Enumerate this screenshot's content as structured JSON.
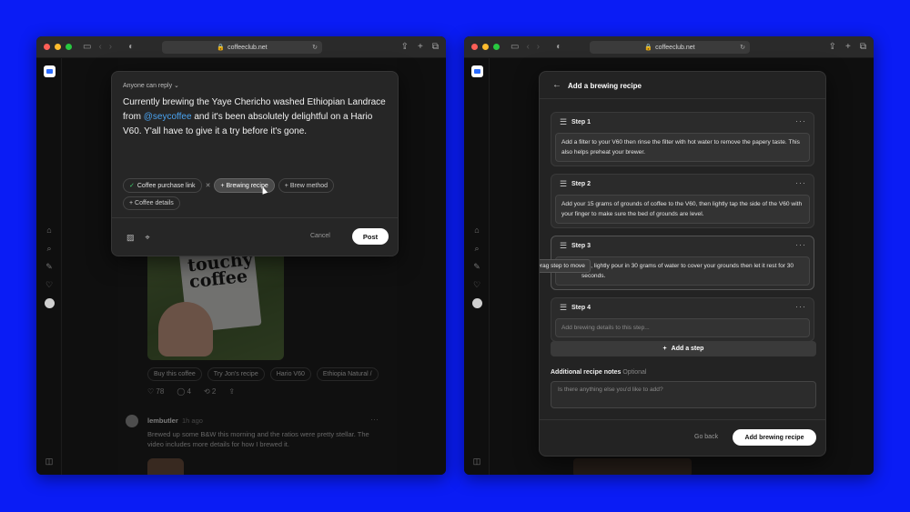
{
  "browser": {
    "url": "coffeeclub.net"
  },
  "composer": {
    "reply_setting": "Anyone can reply",
    "text_before": "Currently brewing the Yaye Chericho washed Ethiopian Landrace from ",
    "mention": "@seycoffee",
    "text_after": " and it's been absolutely delightful on a Hario V60. Y'all have to give it a try before it's gone.",
    "chips": {
      "purchase_link": "Coffee purchase link",
      "brewing_recipe": "+ Brewing recipe",
      "brew_method": "+ Brew method",
      "coffee_details": "+ Coffee details"
    },
    "cancel_label": "Cancel",
    "post_label": "Post"
  },
  "feed": {
    "bag_text": "touchy coffee",
    "tags": [
      "Buy this coffee",
      "Try Jon's recipe",
      "Hario V60",
      "Ethiopia Natural /"
    ],
    "actions": {
      "likes": "78",
      "comments": "4",
      "reposts": "2"
    },
    "post2": {
      "username": "lembutler",
      "time": "1h ago",
      "body": "Brewed up some B&W this morning and the ratios were pretty stellar. The video includes more details for how I brewed it."
    }
  },
  "recipe_modal": {
    "title": "Add a brewing recipe",
    "steps": [
      {
        "label": "Step 1",
        "text": "Add a filter to your V60 then rinse the filter with hot water to remove the papery taste. This also helps preheat your brewer."
      },
      {
        "label": "Step 2",
        "text": "Add your 15 grams of grounds of coffee to the V60, then lightly tap the side of the V60 with your finger to make sure the bed of grounds are level."
      },
      {
        "label": "Step 3",
        "text": "…n, lightly pour in 30 grams of water to cover your grounds then let it rest for 30 seconds."
      },
      {
        "label": "Step 4",
        "placeholder": "Add brewing details to this step..."
      }
    ],
    "tooltip": "Drag step to move",
    "add_step": "Add a step",
    "notes_label": "Additional recipe notes",
    "notes_optional": "Optional",
    "notes_placeholder": "Is there anything else you'd like to add?",
    "go_back": "Go back",
    "submit": "Add brewing recipe"
  }
}
